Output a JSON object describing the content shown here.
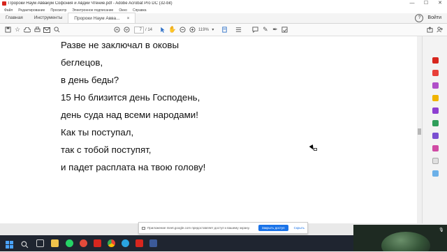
{
  "window": {
    "title": "Пророки Наум Аввакум Софония и Авдий Чтение.pdf - Adobe Acrobat Pro DC (32-bit)",
    "controls": [
      "—",
      "☐",
      "✕"
    ]
  },
  "menu": [
    "Файл",
    "Редактирование",
    "Просмотр",
    "Электронное подписание",
    "Окно",
    "Справка"
  ],
  "tabs": {
    "home": "Главная",
    "tools": "Инструменты",
    "document": "Пророки Наум Авва...",
    "document_close": "×",
    "help": "?",
    "signin": "Войти"
  },
  "toolbar": {
    "page_current": "7",
    "page_total": "/ 14",
    "zoom": "119%"
  },
  "document": {
    "lines": [
      "Разве не заключал в оковы",
      "беглецов,",
      "в день беды?",
      "15 Но близится день Господень,",
      "день суда над всеми народами!",
      "Как ты поступал,",
      "так с тобой поступят,",
      "и падет расплата на твою голову!"
    ]
  },
  "share_notice": {
    "message": "Приложение meet.google.com предоставляет доступ к вашему экрану.",
    "stop_label": "Закрыть доступ",
    "hide_label": "Скрыть"
  },
  "colors": {
    "accent": "#1a73e8",
    "acrobat_red": "#d7261e",
    "taskbar": "#1f2530"
  }
}
